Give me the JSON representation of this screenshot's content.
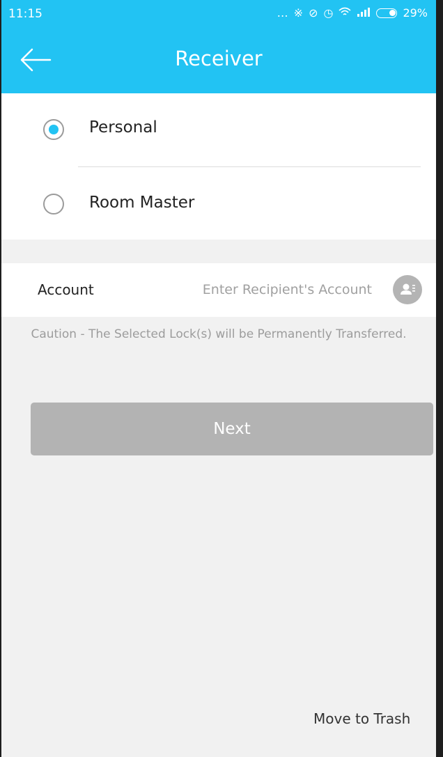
{
  "status_bar": {
    "time": "11:15",
    "icons": [
      "more-dots-icon",
      "bluetooth-icon",
      "mute-icon",
      "alarm-icon",
      "wifi-icon",
      "signal-icon",
      "battery-icon"
    ],
    "battery_percent": "29%"
  },
  "header": {
    "title": "Receiver",
    "back_icon": "arrow-left-icon"
  },
  "receiver_options": [
    {
      "label": "Personal",
      "selected": true
    },
    {
      "label": "Room Master",
      "selected": false
    }
  ],
  "account": {
    "label": "Account",
    "value": "",
    "placeholder": "Enter Recipient's Account",
    "contact_icon": "contact-book-icon"
  },
  "caution_text": "Caution - The Selected Lock(s) will be Permanently Transferred.",
  "next_button_label": "Next",
  "move_to_trash_label": "Move to Trash",
  "colors": {
    "primary": "#22c3f3",
    "background": "#f1f1f1",
    "button_disabled": "#b3b3b3"
  }
}
